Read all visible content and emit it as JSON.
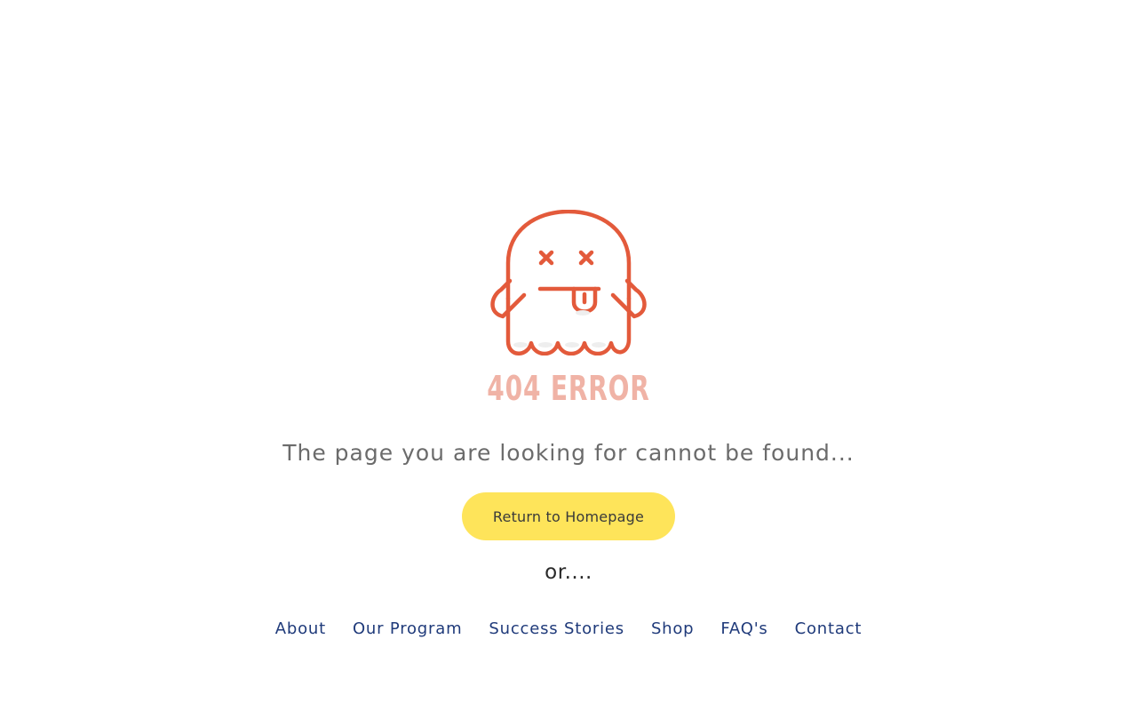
{
  "error": {
    "code_label": "404 ERROR",
    "message": "The page you are looking for cannot be found...",
    "illustration_icon": "dead-ghost-icon"
  },
  "actions": {
    "home_button_label": "Return to Homepage",
    "or_text": "or...."
  },
  "nav": {
    "links": [
      "About",
      "Our Program",
      "Success Stories",
      "Shop",
      "FAQ's",
      "Contact"
    ]
  },
  "colors": {
    "ghost_outline": "#e35a3b",
    "error_code": "#f0b3a6",
    "button_bg": "#fee45a",
    "nav_link": "#1f3a7a",
    "message_text": "#6b6b6b"
  }
}
